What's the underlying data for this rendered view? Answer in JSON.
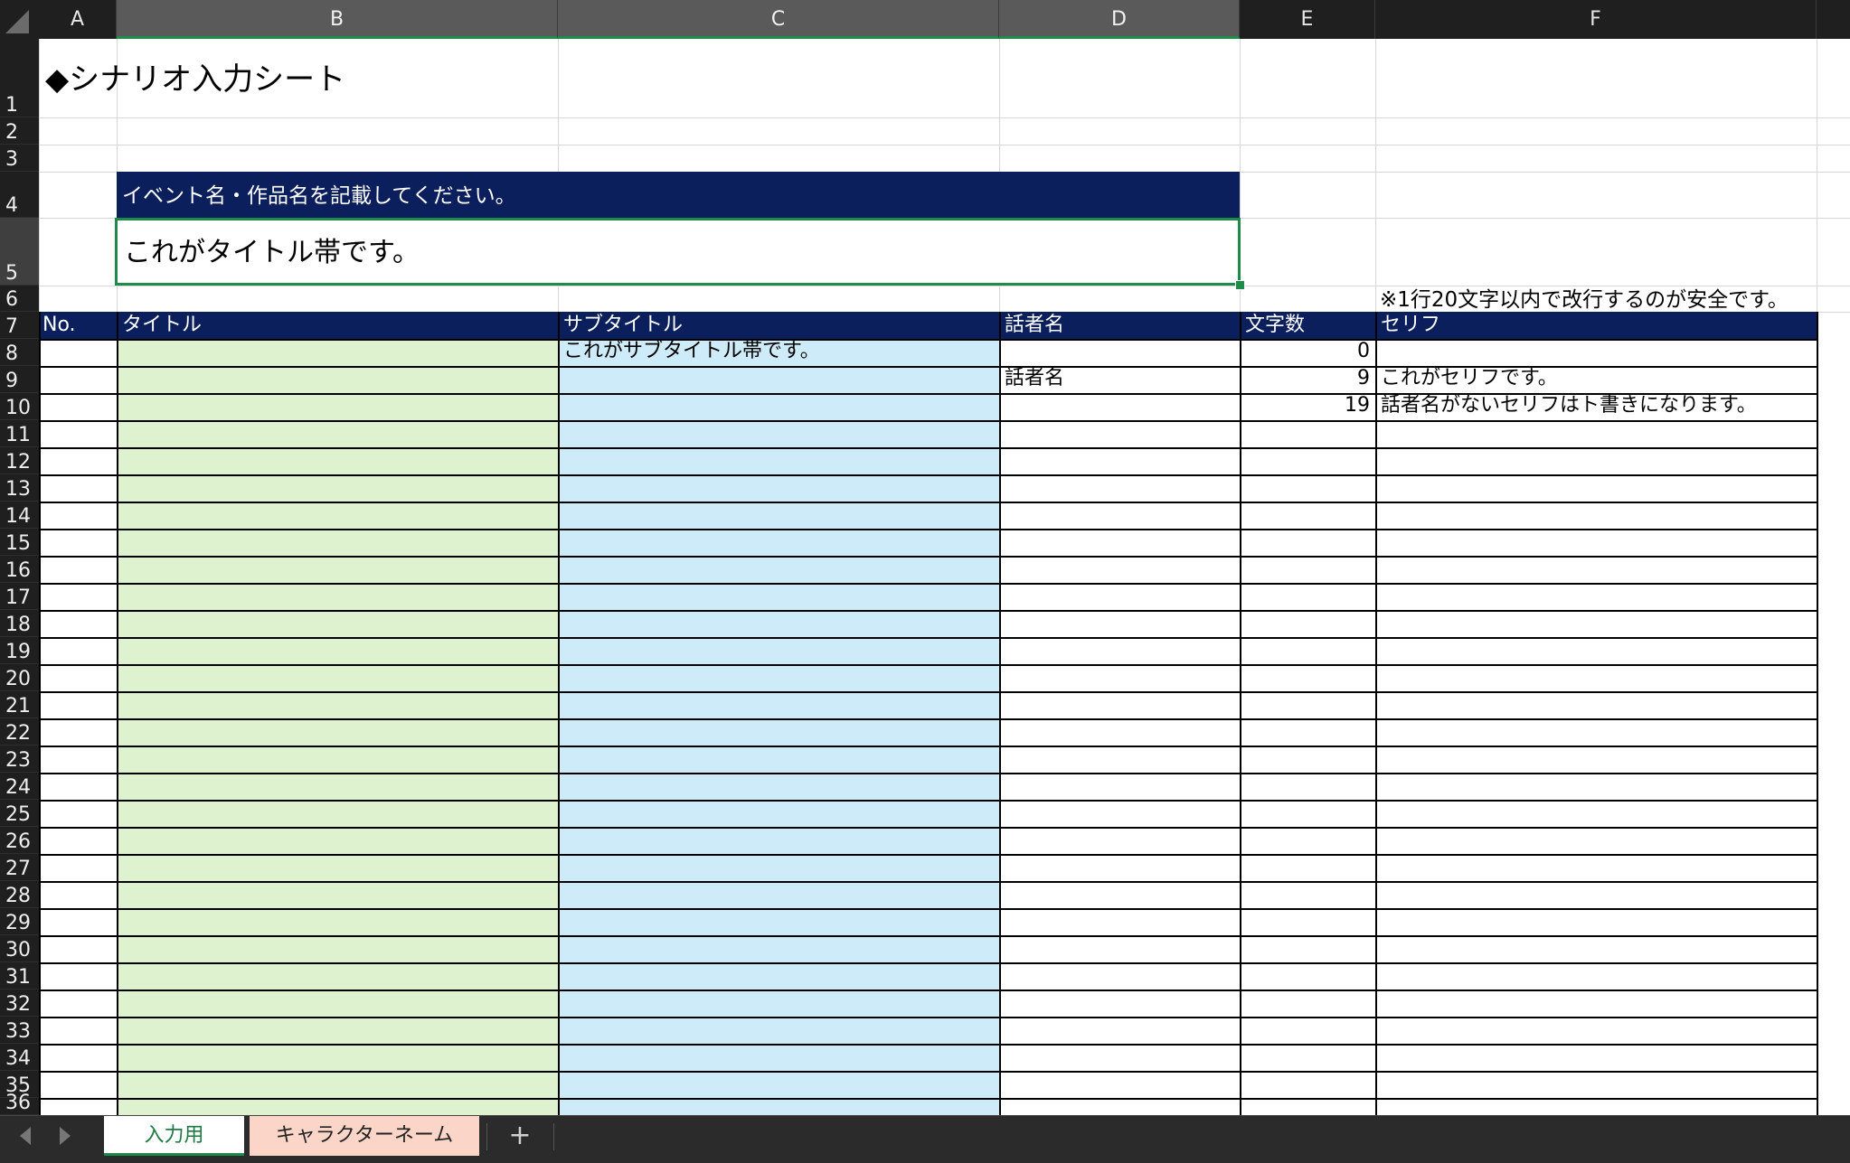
{
  "columns": [
    "A",
    "B",
    "C",
    "D",
    "E",
    "F"
  ],
  "rows": [
    "1",
    "2",
    "3",
    "4",
    "5",
    "6",
    "7",
    "8",
    "9",
    "10",
    "11",
    "12",
    "13",
    "14",
    "15",
    "16",
    "17",
    "18",
    "19",
    "20",
    "21",
    "22",
    "23",
    "24",
    "25",
    "26",
    "27",
    "28",
    "29",
    "30",
    "31",
    "32",
    "33",
    "34",
    "35",
    "36"
  ],
  "sheet_title": "◆シナリオ入力シート",
  "event_header": "イベント名・作品名を記載してください。",
  "title_band": "これがタイトル帯です。",
  "note": "※1行20文字以内で改行するのが安全です。",
  "table_headers": {
    "no": "No.",
    "title": "タイトル",
    "subtitle": "サブタイトル",
    "speaker": "話者名",
    "char_count": "文字数",
    "line": "セリフ"
  },
  "entries": [
    {
      "subtitle": "これがサブタイトル帯です。",
      "speaker": "",
      "char_count": "0",
      "line": ""
    },
    {
      "subtitle": "",
      "speaker": "話者名",
      "char_count": "9",
      "line": "これがセリフです。"
    },
    {
      "subtitle": "",
      "speaker": "",
      "char_count": "19",
      "line": "話者名がないセリフはト書きになります。"
    }
  ],
  "tabs": {
    "active": "入力用",
    "second": "キャラクターネーム",
    "add": "+"
  },
  "colors": {
    "header_navy": "#0b1f5c",
    "title_fill": "#dff2d0",
    "subtitle_fill": "#cdebf8",
    "selection_green": "#1e8b4b",
    "tab2_fill": "#fbd5c8"
  }
}
